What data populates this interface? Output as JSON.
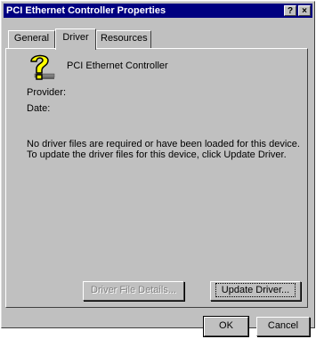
{
  "window": {
    "title": "PCI Ethernet Controller Properties",
    "help_label": "?",
    "close_label": "×"
  },
  "tabs": [
    {
      "label": "General",
      "active": false
    },
    {
      "label": "Driver",
      "active": true
    },
    {
      "label": "Resources",
      "active": false
    }
  ],
  "device": {
    "name": "PCI Ethernet Controller",
    "icon": "unknown-device-question-icon"
  },
  "fields": {
    "provider_label": "Provider:",
    "date_label": "Date:"
  },
  "message": "No driver files are required or have been loaded for this device.  To update the driver files for this device, click Update Driver.",
  "buttons": {
    "driver_file_details": "Driver File Details...",
    "update_driver": "Update Driver...",
    "ok": "OK",
    "cancel": "Cancel"
  },
  "colors": {
    "titlebar": "#000080",
    "face": "#c0c0c0",
    "icon_yellow": "#ffff00"
  }
}
